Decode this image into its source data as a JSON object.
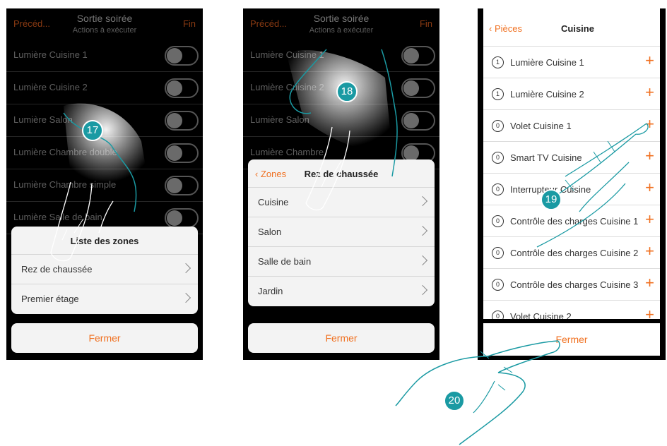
{
  "panel1": {
    "header": {
      "back": "Précéd...",
      "title": "Sortie soirée",
      "subtitle": "Actions à exécuter",
      "done": "Fin"
    },
    "rows": [
      "Lumière Cuisine 1",
      "Lumière Cuisine 2",
      "Lumière Salon",
      "Lumière Chambre double",
      "Lumière Chambre simple",
      "Lumière Salle de bain"
    ],
    "sheet": {
      "title": "Liste des zones",
      "items": [
        "Rez de chaussée",
        "Premier étage"
      ]
    },
    "close": "Fermer",
    "step": "17"
  },
  "panel2": {
    "header": {
      "back": "Précéd...",
      "title": "Sortie soirée",
      "subtitle": "Actions à exécuter",
      "done": "Fin"
    },
    "rows": [
      "Lumière Cuisine 1",
      "Lumière Cuisine 2",
      "Lumière Salon",
      "Lumière Chambre"
    ],
    "sheet": {
      "back": "Zones",
      "title": "Rez de chaussée",
      "items": [
        "Cuisine",
        "Salon",
        "Salle de bain",
        "Jardin"
      ]
    },
    "close": "Fermer",
    "step": "18"
  },
  "panel3": {
    "header": {
      "back": "Pièces",
      "title": "Cuisine"
    },
    "items": [
      {
        "badge": "1",
        "label": "Lumière Cuisine 1"
      },
      {
        "badge": "1",
        "label": "Lumière Cuisine 2"
      },
      {
        "badge": "0",
        "label": "Volet Cuisine 1"
      },
      {
        "badge": "0",
        "label": "Smart TV Cuisine"
      },
      {
        "badge": "0",
        "label": "Interrupteur Cuisine"
      },
      {
        "badge": "0",
        "label": "Contrôle des charges Cuisine 1"
      },
      {
        "badge": "0",
        "label": "Contrôle des charges Cuisine 2"
      },
      {
        "badge": "0",
        "label": "Contrôle des charges Cuisine 3"
      },
      {
        "badge": "0",
        "label": "Volet Cuisine 2"
      }
    ],
    "plus_icon": "+",
    "close": "Fermer",
    "step_select": "19",
    "step_close": "20"
  },
  "colors": {
    "accent": "#f07020",
    "step": "#1a9aa3"
  }
}
